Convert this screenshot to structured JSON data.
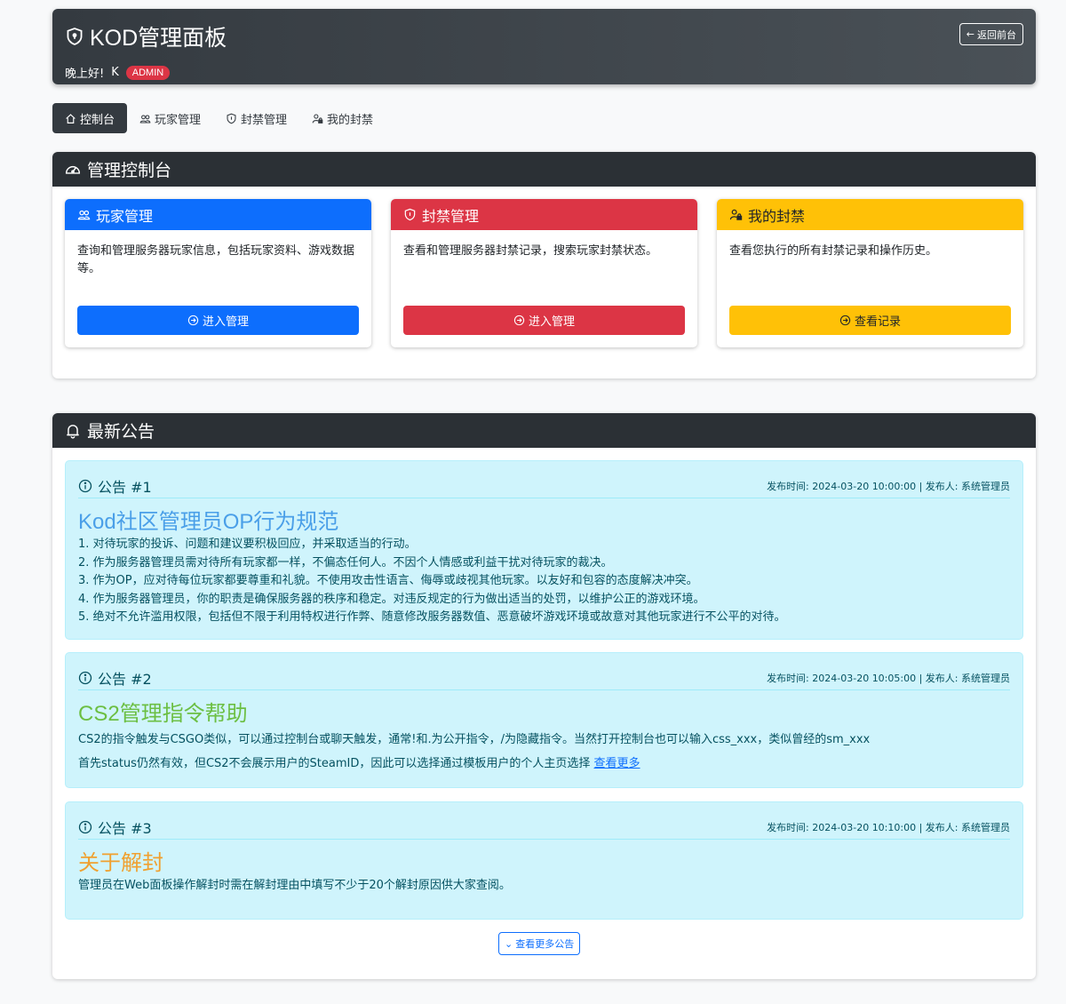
{
  "header": {
    "title": "KOD管理面板",
    "greeting": "晚上好!",
    "username": "K",
    "role_badge": "ADMIN",
    "back_button": "返回前台"
  },
  "tabs": [
    {
      "label": "控制台",
      "icon": "house-icon",
      "active": true
    },
    {
      "label": "玩家管理",
      "icon": "people-icon",
      "active": false
    },
    {
      "label": "封禁管理",
      "icon": "shield-icon",
      "active": false
    },
    {
      "label": "我的封禁",
      "icon": "person-lock-icon",
      "active": false
    }
  ],
  "dashboard": {
    "title": "管理控制台",
    "cards": [
      {
        "title": "玩家管理",
        "text": "查询和管理服务器玩家信息，包括玩家资料、游戏数据等。",
        "button": "进入管理",
        "color": "#0d6efd"
      },
      {
        "title": "封禁管理",
        "text": "查看和管理服务器封禁记录，搜索玩家封禁状态。",
        "button": "进入管理",
        "color": "#dc3545"
      },
      {
        "title": "我的封禁",
        "text": "查看您执行的所有封禁记录和操作历史。",
        "button": "查看记录",
        "color": "#ffc107"
      }
    ]
  },
  "announcements": {
    "title": "最新公告",
    "items": [
      {
        "label": "公告 #1",
        "meta": "发布时间: 2024-03-20 10:00:00 | 发布人: 系统管理员",
        "title": "Kod社区管理员OP行为规范",
        "title_color": "#4a9fe8",
        "lines": [
          "1. 对待玩家的投诉、问题和建议要积极回应，并采取适当的行动。",
          "2. 作为服务器管理员需对待所有玩家都一样，不偏态任何人。不因个人情感或利益干扰对待玩家的裁决。",
          "3. 作为OP，应对待每位玩家都要尊重和礼貌。不使用攻击性语言、侮辱或歧视其他玩家。以友好和包容的态度解决冲突。",
          "4. 作为服务器管理员，你的职责是确保服务器的秩序和稳定。对违反规定的行为做出适当的处罚，以维护公正的游戏环境。",
          "5. 绝对不允许滥用权限，包括但不限于利用特权进行作弊、随意修改服务器数值、恶意破坏游戏环境或故意对其他玩家进行不公平的对待。"
        ]
      },
      {
        "label": "公告 #2",
        "meta": "发布时间: 2024-03-20 10:05:00 | 发布人: 系统管理员",
        "title": "CS2管理指令帮助",
        "title_color": "#6cbf43",
        "lines": [
          "CS2的指令触发与CSGO类似，可以通过控制台或聊天触发，通常!和.为公开指令，/为隐藏指令。当然打开控制台也可以输入css_xxx，类似曾经的sm_xxx",
          "首先status仍然有效，但CS2不会展示用户的SteamID，因此可以选择通过模板用户的个人主页选择"
        ],
        "link": "查看更多"
      },
      {
        "label": "公告 #3",
        "meta": "发布时间: 2024-03-20 10:10:00 | 发布人: 系统管理员",
        "title": "关于解封",
        "title_color": "#f0a030",
        "lines": [
          "管理员在Web面板操作解封时需在解封理由中填写不少于20个解封原因供大家查阅。"
        ]
      }
    ],
    "more_button": "查看更多公告"
  }
}
